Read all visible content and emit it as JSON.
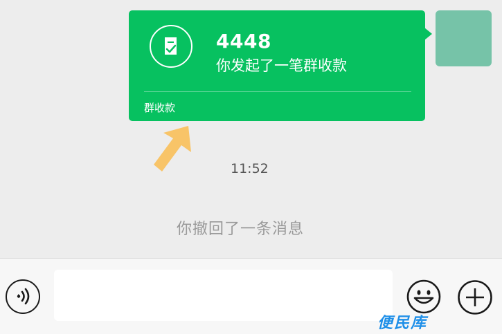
{
  "payment_card": {
    "amount": "4448",
    "description": "你发起了一笔群收款",
    "label": "群收款",
    "icon": "receipt-check-icon",
    "accent_color": "#07c160"
  },
  "timestamp": "11:52",
  "system_message": "你撤回了一条消息",
  "input_bar": {
    "voice_icon": "voice-icon",
    "emoji_icon": "emoji-icon",
    "plus_icon": "plus-icon",
    "input_value": ""
  },
  "annotation": {
    "arrow_color": "#f8c468",
    "arrow_icon": "arrow-up-right-icon"
  },
  "watermark": "便民库"
}
